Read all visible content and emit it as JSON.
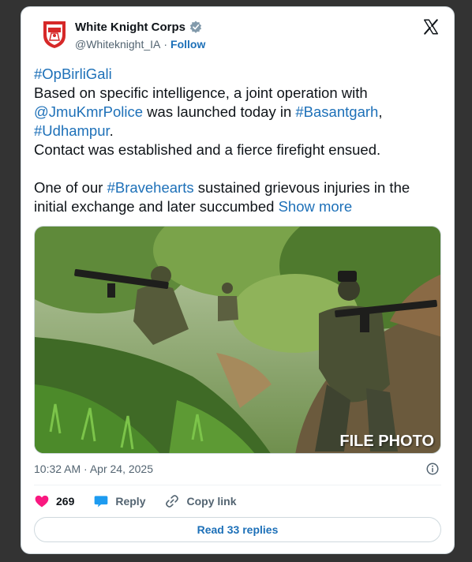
{
  "author": {
    "name": "White Knight Corps",
    "handle": "@Whiteknight_IA",
    "separator": "·",
    "follow_label": "Follow",
    "verified_icon": "verified-badge-icon",
    "avatar_icon": "white-knight-corps-emblem"
  },
  "tweet": {
    "hashtag_op": "#OpBirliGali",
    "line1": "Based on specific intelligence, a joint operation with",
    "mention_police": "@JmuKmrPolice",
    "line2_mid": " was launched today in ",
    "hashtag_basantgarh": "#Basantgarh",
    "comma": ",",
    "hashtag_udhampur": "#Udhampur",
    "period": ".",
    "line4": "Contact was established and a fierce firefight ensued.",
    "line5_pre": "One of our ",
    "hashtag_bravehearts": "#Bravehearts",
    "line5_post": " sustained grievous injuries in the initial exchange and later succumbed ",
    "show_more": "Show more"
  },
  "media": {
    "watermark": "FILE PHOTO"
  },
  "meta": {
    "timestamp": "10:32 AM · Apr 24, 2025"
  },
  "actions": {
    "likes_count": "269",
    "reply_label": "Reply",
    "copy_link_label": "Copy link",
    "read_replies_label": "Read 33 replies"
  },
  "colors": {
    "link": "#1d70b8",
    "heart": "#f91880",
    "reply_bubble": "#1d9bf0",
    "text": "#0f1419",
    "muted": "#536471"
  }
}
